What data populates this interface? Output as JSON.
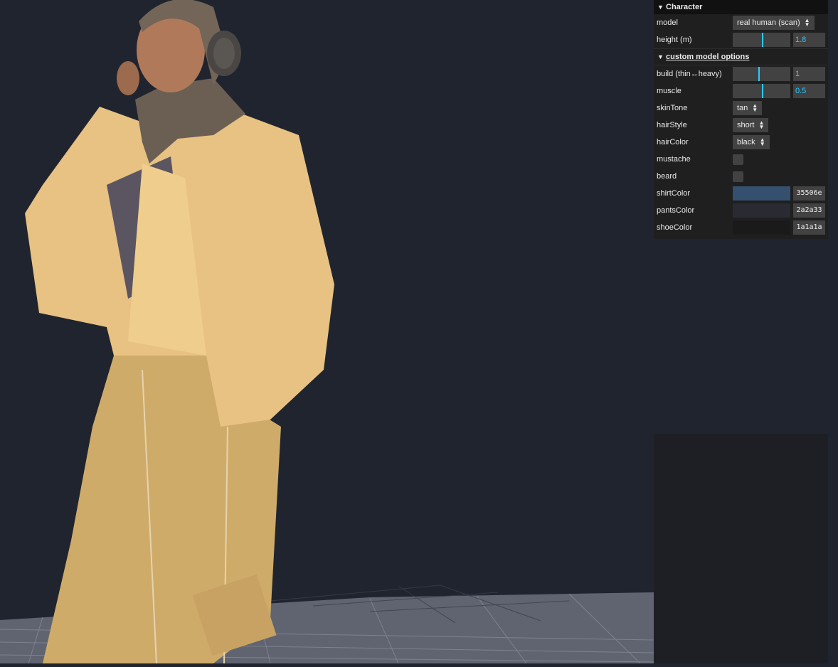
{
  "gui": {
    "title": "Character",
    "model_label": "model",
    "model_value": "real human (scan)",
    "height_label": "height (m)",
    "height_value": "1.8",
    "height_fraction": 0.5,
    "sub_title": "custom model options",
    "build_label": "build (thin↔heavy)",
    "build_value": "1",
    "build_fraction": 0.45,
    "muscle_label": "muscle",
    "muscle_value": "0.5",
    "muscle_fraction": 0.5,
    "skinTone_label": "skinTone",
    "skinTone_value": "tan",
    "hairStyle_label": "hairStyle",
    "hairStyle_value": "short",
    "hairColor_label": "hairColor",
    "hairColor_value": "black",
    "mustache_label": "mustache",
    "mustache_checked": false,
    "beard_label": "beard",
    "beard_checked": false,
    "shirtColor_label": "shirtColor",
    "shirtColor_value": "35506e",
    "pantsColor_label": "pantsColor",
    "pantsColor_value": "2a2a33",
    "shoeColor_label": "shoeColor",
    "shoeColor_value": "1a1a1a"
  },
  "colors": {
    "background": "#20242f",
    "accent": "#2cc9ff",
    "shirt": "#35506e",
    "pants": "#2a2a33",
    "shoe": "#1a1a1a"
  },
  "icons": {
    "title_chevron": "chevron-down-icon",
    "sub_chevron": "chevron-down-icon",
    "select_arrows": "up-down-arrows-icon"
  }
}
